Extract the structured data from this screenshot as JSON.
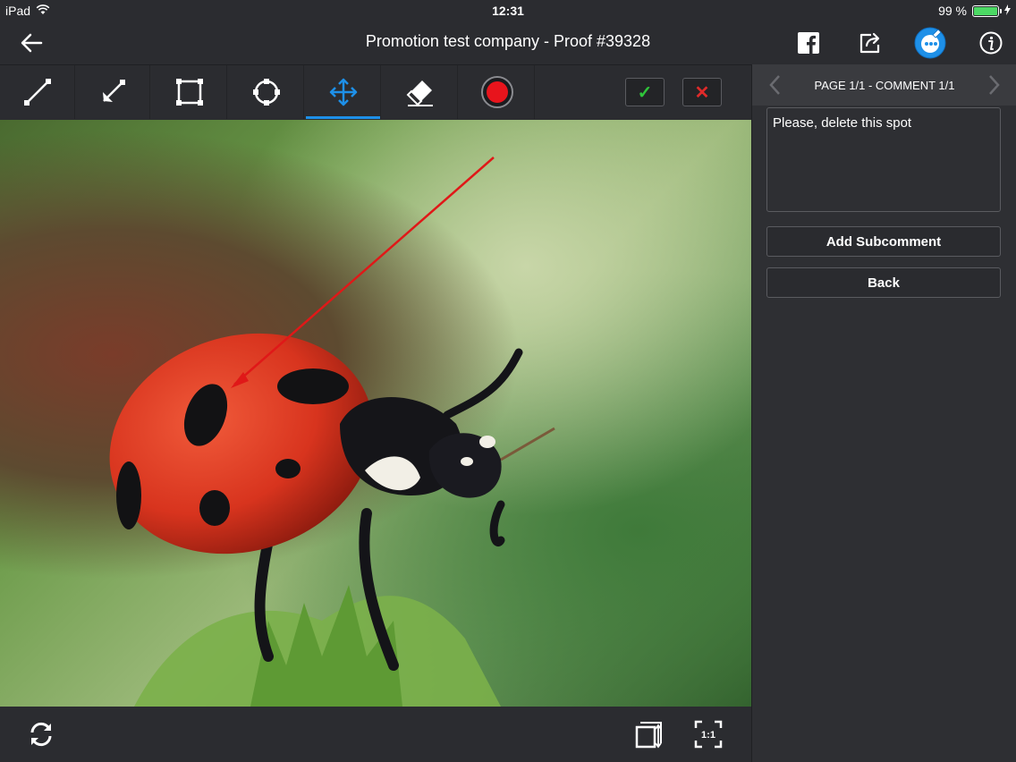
{
  "status_bar": {
    "device": "iPad",
    "time": "12:31",
    "battery_text": "99 %"
  },
  "nav": {
    "title": "Promotion test company - Proof #39328",
    "icons": [
      "back-arrow-icon",
      "facebook-icon",
      "share-icon",
      "annotate-avatar-icon",
      "info-icon"
    ]
  },
  "toolbar": {
    "tools": [
      "line-tool",
      "arrow-tool",
      "rectangle-tool",
      "circle-tool",
      "move-tool",
      "eraser-tool",
      "color-tool"
    ],
    "active_tool": "move-tool",
    "accept_mark": "✓",
    "reject_mark": "✕"
  },
  "image": {
    "subject": "ladybug photo"
  },
  "panel": {
    "pager_text": "PAGE 1/1 - COMMENT 1/1",
    "comment_text": "Please, delete this spot",
    "add_subcomment_label": "Add Subcomment",
    "back_label": "Back"
  },
  "bottom_bar": {
    "fit_label": "1:1"
  },
  "colors": {
    "accent": "#1e90e8",
    "record_red": "#e8141c",
    "accept_green": "#2fc43a",
    "reject_red": "#e02a2a",
    "annotation_red": "#e01818"
  }
}
